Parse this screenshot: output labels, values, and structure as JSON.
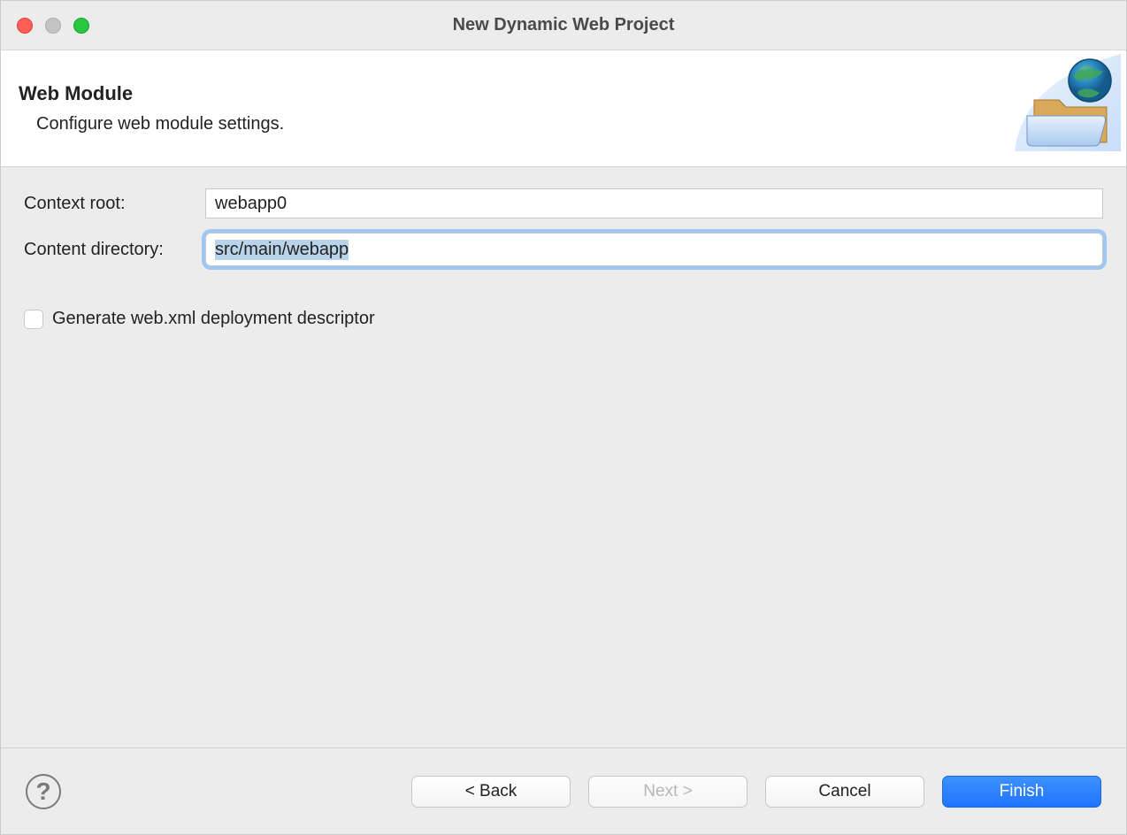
{
  "window": {
    "title": "New Dynamic Web Project"
  },
  "header": {
    "title": "Web Module",
    "subtitle": "Configure web module settings."
  },
  "form": {
    "context_root_label": "Context root:",
    "context_root_value": "webapp0",
    "content_directory_label": "Content directory:",
    "content_directory_value": "src/main/webapp",
    "generate_webxml_label": "Generate web.xml deployment descriptor",
    "generate_webxml_checked": false
  },
  "footer": {
    "back_label": "< Back",
    "next_label": "Next >",
    "cancel_label": "Cancel",
    "finish_label": "Finish"
  }
}
